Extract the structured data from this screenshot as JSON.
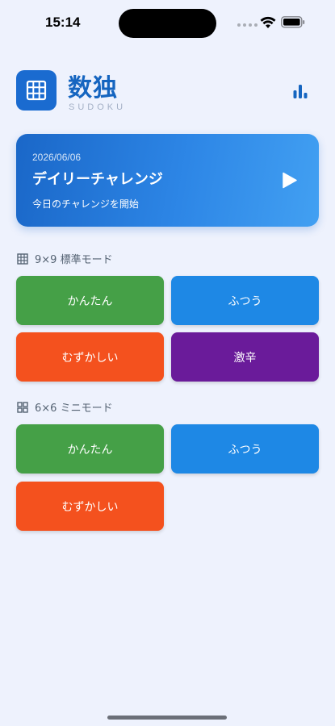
{
  "status_bar": {
    "time": "15:14"
  },
  "header": {
    "title": "数独",
    "subtitle": "SUDOKU"
  },
  "daily": {
    "date": "2026/06/06",
    "title": "デイリーチャレンジ",
    "subtitle": "今日のチャレンジを開始"
  },
  "sections": [
    {
      "label": "9×9 標準モード",
      "buttons": [
        {
          "label": "かんたん",
          "color": "#45a047"
        },
        {
          "label": "ふつう",
          "color": "#1e88e5"
        },
        {
          "label": "むずかしい",
          "color": "#f4511e"
        },
        {
          "label": "激辛",
          "color": "#6a1b9a"
        }
      ]
    },
    {
      "label": "6×6 ミニモード",
      "buttons": [
        {
          "label": "かんたん",
          "color": "#45a047"
        },
        {
          "label": "ふつう",
          "color": "#1e88e5"
        },
        {
          "label": "むずかしい",
          "color": "#f4511e"
        }
      ]
    }
  ],
  "colors": {
    "background": "#eef2fd",
    "accent": "#1565c0",
    "card_gradient_start": "#1a67c8",
    "card_gradient_end": "#42a0f2"
  }
}
